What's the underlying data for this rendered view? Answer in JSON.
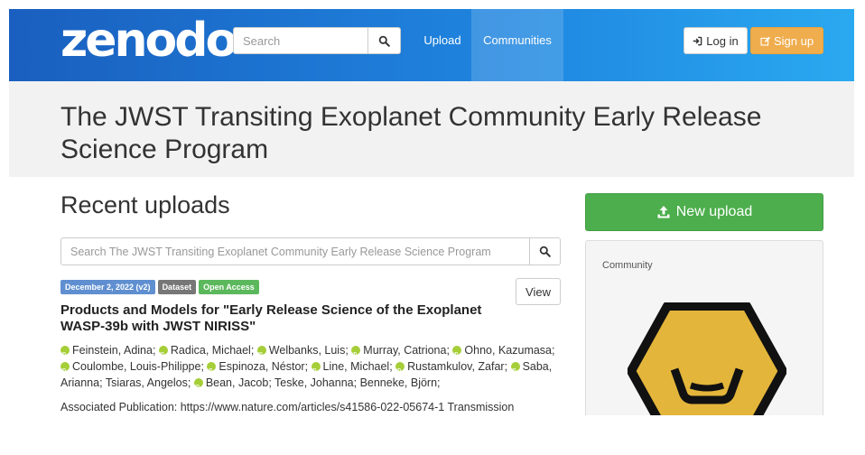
{
  "header": {
    "logo_text": "zenodo",
    "search_placeholder": "Search",
    "nav": {
      "upload": "Upload",
      "communities": "Communities"
    },
    "login_label": "Log in",
    "signup_label": "Sign up",
    "colors": {
      "navbar_start": "#1a5fbf",
      "navbar_end": "#2aa9f0",
      "signup": "#f0ad4e"
    }
  },
  "community": {
    "title": "The JWST Transiting Exoplanet Community Early Release Science Program"
  },
  "main": {
    "section_title": "Recent uploads",
    "search_placeholder": "Search The JWST Transiting Exoplanet Community Early Release Science Program",
    "records": [
      {
        "badges": {
          "date": "December 2, 2022 (v2)",
          "type": "Dataset",
          "access": "Open Access"
        },
        "view_label": "View",
        "title": "Products and Models for \"Early Release Science of the Exoplanet WASP-39b with JWST NIRISS\"",
        "authors": [
          {
            "name": "Feinstein, Adina",
            "orcid": true
          },
          {
            "name": "Radica, Michael",
            "orcid": true
          },
          {
            "name": "Welbanks, Luis",
            "orcid": true
          },
          {
            "name": "Murray, Catriona",
            "orcid": true
          },
          {
            "name": "Ohno, Kazumasa",
            "orcid": true
          },
          {
            "name": "Coulombe, Louis-Philippe",
            "orcid": true
          },
          {
            "name": "Espinoza, Néstor",
            "orcid": true
          },
          {
            "name": "Line, Michael",
            "orcid": true
          },
          {
            "name": "Rustamkulov, Zafar",
            "orcid": true
          },
          {
            "name": "Saba, Arianna",
            "orcid": true
          },
          {
            "name": "Tsiaras, Angelos",
            "orcid": false
          },
          {
            "name": "Bean, Jacob",
            "orcid": true
          },
          {
            "name": "Teske, Johanna",
            "orcid": false
          },
          {
            "name": "Benneke, Björn",
            "orcid": false
          }
        ],
        "description": "Associated Publication: https://www.nature.com/articles/s41586-022-05674-1   Transmission"
      }
    ]
  },
  "sidebar": {
    "new_upload_label": "New upload",
    "panel_label": "Community",
    "colors": {
      "new_upload": "#4cae4c",
      "logo_fill": "#e3b53a",
      "logo_outline": "#111111"
    }
  }
}
